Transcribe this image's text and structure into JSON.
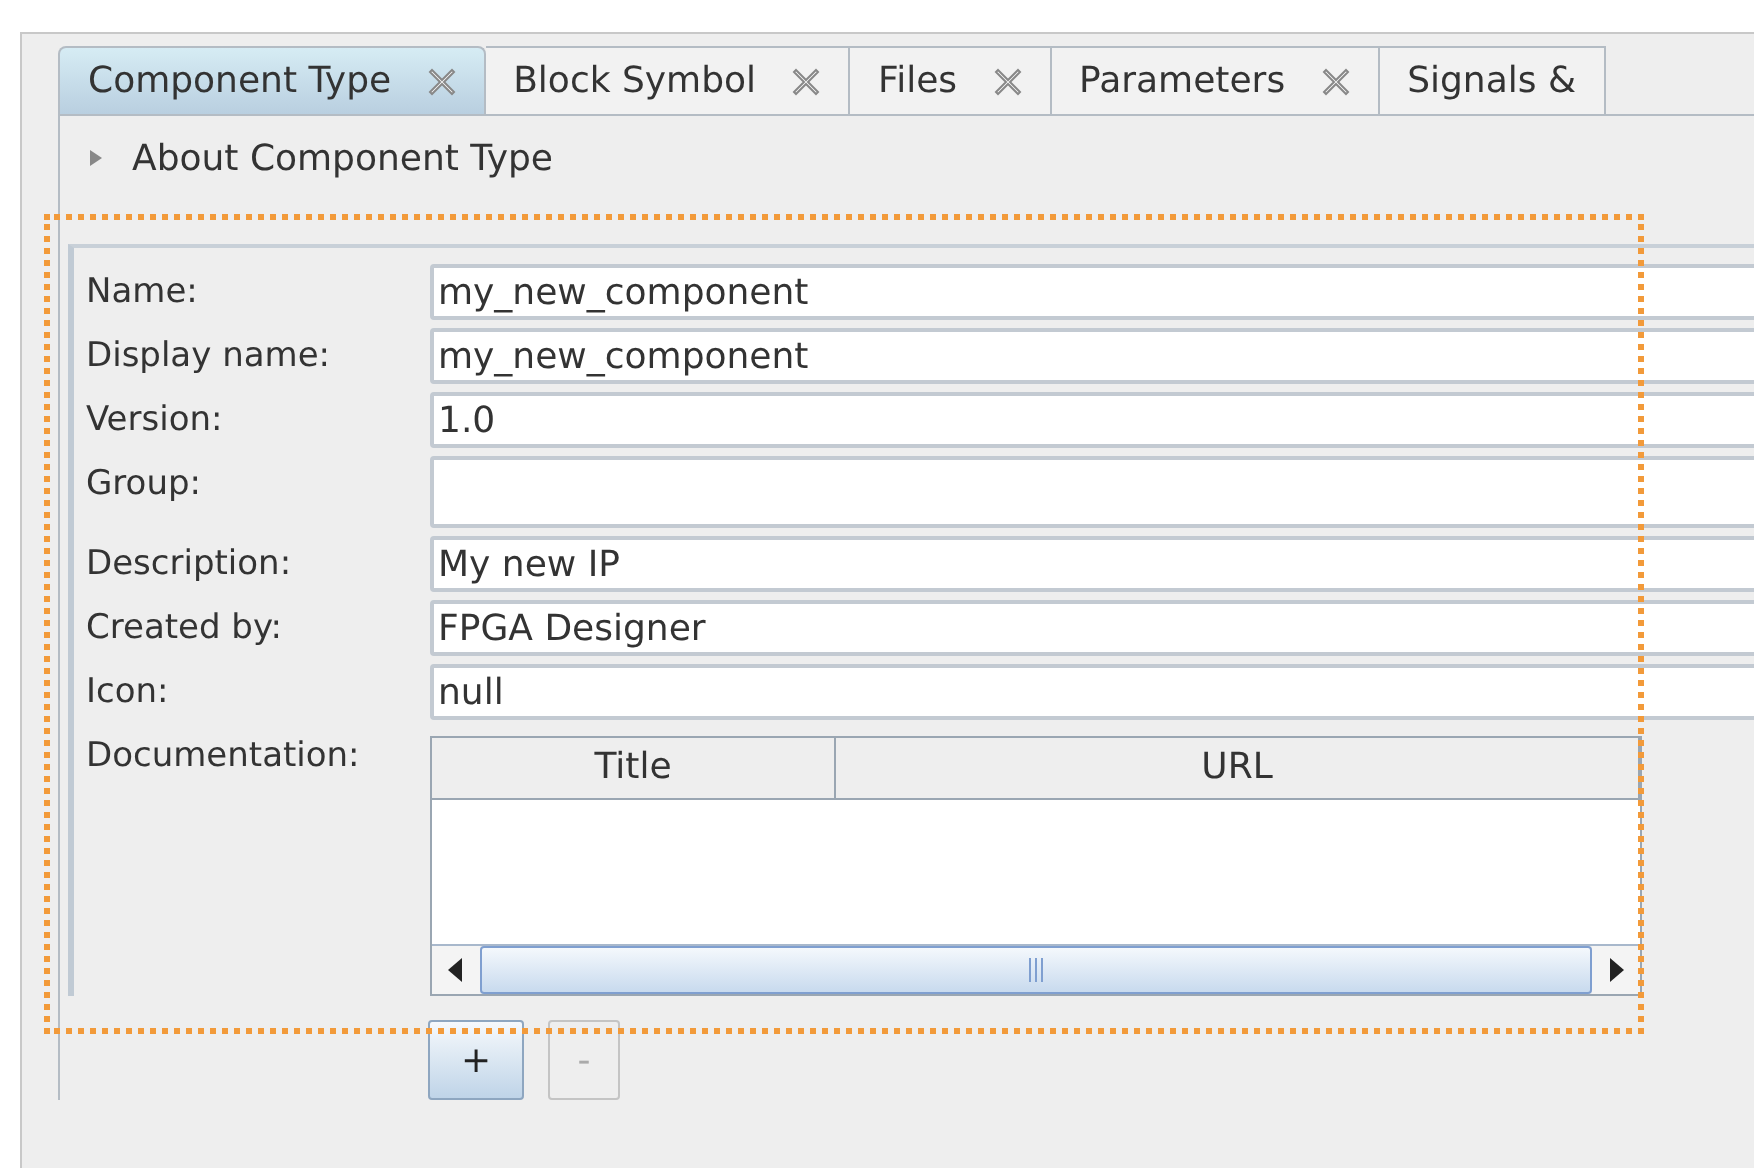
{
  "tabs": [
    {
      "label": "Component Type",
      "selected": true
    },
    {
      "label": "Block Symbol",
      "selected": false
    },
    {
      "label": "Files",
      "selected": false
    },
    {
      "label": "Parameters",
      "selected": false
    },
    {
      "label": "Signals &",
      "selected": false
    }
  ],
  "about": {
    "label": "About Component Type",
    "expanded": false
  },
  "fields": [
    {
      "label": "Name:",
      "value": "my_new_component",
      "kind": "text"
    },
    {
      "label": "Display name:",
      "value": "my_new_component",
      "kind": "text"
    },
    {
      "label": "Version:",
      "value": "1.0",
      "kind": "text"
    },
    {
      "label": "Group:",
      "kind": "tall"
    },
    {
      "label": "Description:",
      "value": "My new IP",
      "kind": "text"
    },
    {
      "label": "Created by:",
      "value": "FPGA Designer",
      "kind": "text"
    },
    {
      "label": "Icon:",
      "value": "null",
      "kind": "text"
    }
  ],
  "documentation": {
    "label": "Documentation:",
    "columns": [
      "Title",
      "URL"
    ]
  },
  "buttons": [
    {
      "label": "+",
      "disabled": false
    },
    {
      "label": "-",
      "disabled": true
    }
  ]
}
